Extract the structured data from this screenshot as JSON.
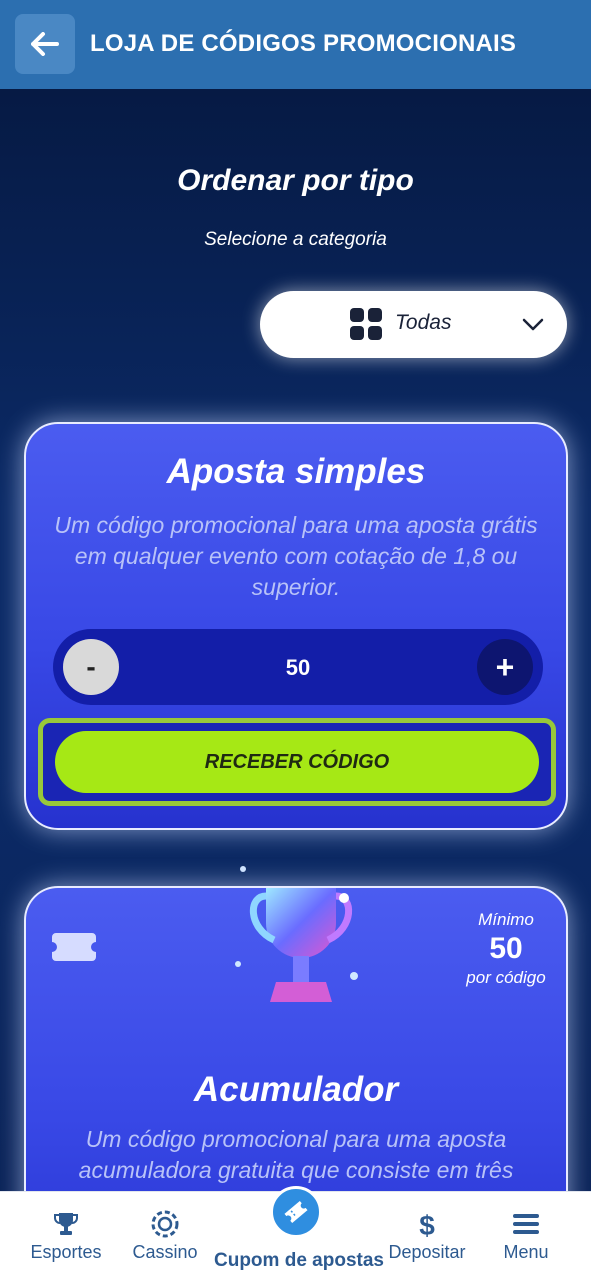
{
  "header": {
    "title": "LOJA DE CÓDIGOS PROMOCIONAIS",
    "back_icon": "arrow-left-icon"
  },
  "sort": {
    "title": "Ordenar por tipo",
    "subtitle": "Selecione a categoria",
    "selected": "Todas",
    "icon": "grid-icon"
  },
  "cards": [
    {
      "title": "Aposta simples",
      "description": "Um código promocional para uma aposta grátis em qualquer evento com cotação de 1,8 ou superior.",
      "stepper": {
        "minus": "-",
        "value": "50",
        "plus": "+"
      },
      "button": "RECEBER CÓDIGO"
    },
    {
      "title": "Acumulador",
      "description": "Um código promocional para uma aposta acumuladora gratuita que consiste em três",
      "min_label": "Mínimo",
      "min_value": "50",
      "min_unit": "por código"
    }
  ],
  "nav": {
    "items": [
      {
        "label": "Esportes",
        "icon": "trophy-icon"
      },
      {
        "label": "Cassino",
        "icon": "casino-chip-icon"
      },
      {
        "label": "Cupom de apostas",
        "icon": "ticket-icon",
        "active": true
      },
      {
        "label": "Depositar",
        "icon": "dollar-icon"
      },
      {
        "label": "Menu",
        "icon": "hamburger-menu-icon"
      }
    ]
  },
  "colors": {
    "header": "#2c6fb0",
    "background": "#0b2a66",
    "card": "#3f50ea",
    "button": "#a6e815",
    "nav_text": "#2d5a90"
  }
}
